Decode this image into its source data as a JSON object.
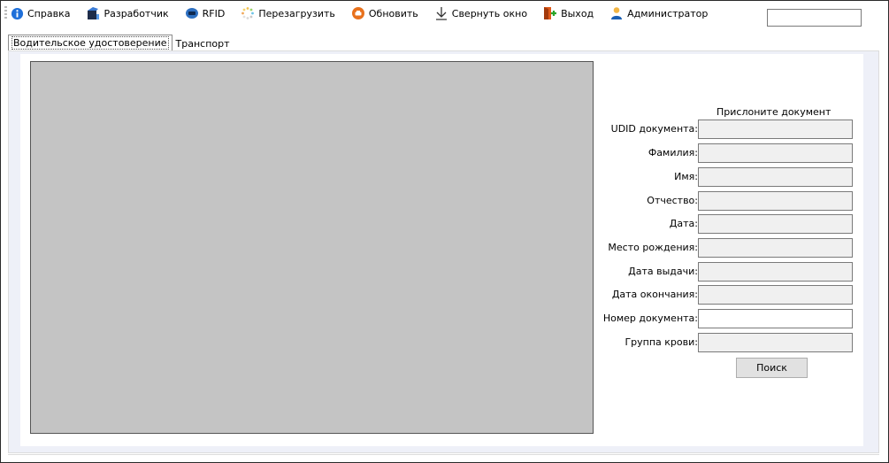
{
  "toolbar": {
    "items": [
      {
        "label": "Справка",
        "icon": "info-icon"
      },
      {
        "label": "Разработчик",
        "icon": "developer-icon"
      },
      {
        "label": "RFID",
        "icon": "rfid-icon"
      },
      {
        "label": "Перезагрузить",
        "icon": "reload-icon"
      },
      {
        "label": "Обновить",
        "icon": "update-icon"
      },
      {
        "label": "Свернуть окно",
        "icon": "minimize-icon"
      },
      {
        "label": "Выход",
        "icon": "exit-icon"
      },
      {
        "label": "Администратор",
        "icon": "user-icon"
      }
    ],
    "search_value": ""
  },
  "tabs": [
    {
      "label": "Водительское удостоверение",
      "active": true
    },
    {
      "label": "Транспорт",
      "active": false
    }
  ],
  "form": {
    "prompt": "Прислоните документ",
    "fields": [
      {
        "label": "UDID документа:",
        "value": "",
        "editable": false
      },
      {
        "label": "Фамилия:",
        "value": "",
        "editable": false
      },
      {
        "label": "Имя:",
        "value": "",
        "editable": false
      },
      {
        "label": "Отчество:",
        "value": "",
        "editable": false
      },
      {
        "label": "Дата:",
        "value": "",
        "editable": false
      },
      {
        "label": "Место рождения:",
        "value": "",
        "editable": false
      },
      {
        "label": "Дата выдачи:",
        "value": "",
        "editable": false
      },
      {
        "label": "Дата окончания:",
        "value": "",
        "editable": false
      },
      {
        "label": "Номер документа:",
        "value": "",
        "editable": true
      },
      {
        "label": "Группа крови:",
        "value": "",
        "editable": false
      }
    ],
    "search_button": "Поиск"
  },
  "colors": {
    "preview_bg": "#c4c4c4",
    "panel_bg": "#eef0f8",
    "info_blue": "#1e6fd9",
    "update_orange": "#e8711c",
    "exit_orange": "#e05a1a",
    "user_blue": "#1a5fb4"
  }
}
